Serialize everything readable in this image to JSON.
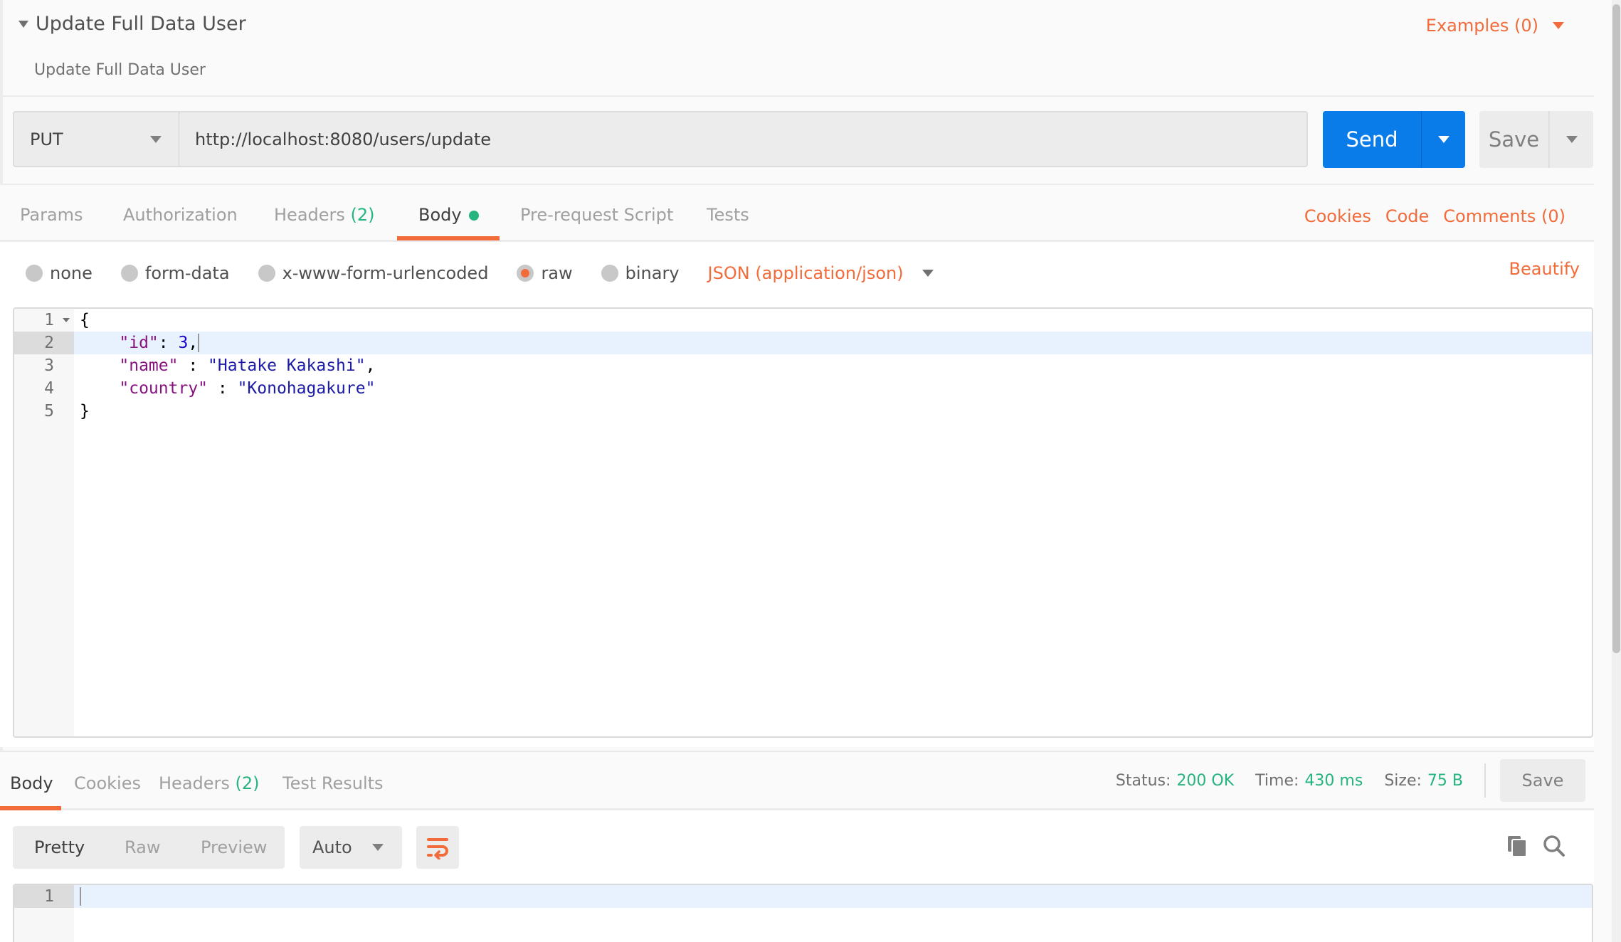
{
  "request": {
    "title": "Update Full Data User",
    "description": "Update Full Data User",
    "examples_label": "Examples (0)",
    "method": "PUT",
    "url": "http://localhost:8080/users/update",
    "send_label": "Send",
    "save_label": "Save"
  },
  "request_tabs": {
    "items": [
      {
        "label": "Params"
      },
      {
        "label": "Authorization"
      },
      {
        "label": "Headers",
        "count": "(2)"
      },
      {
        "label": "Body",
        "active": true,
        "indicator": "green-dot"
      },
      {
        "label": "Pre-request Script"
      },
      {
        "label": "Tests"
      }
    ],
    "right_links": [
      "Cookies",
      "Code",
      "Comments (0)"
    ]
  },
  "body_options": {
    "modes": [
      {
        "label": "none",
        "selected": false
      },
      {
        "label": "form-data",
        "selected": false
      },
      {
        "label": "x-www-form-urlencoded",
        "selected": false
      },
      {
        "label": "raw",
        "selected": true
      },
      {
        "label": "binary",
        "selected": false
      }
    ],
    "content_type": "JSON (application/json)",
    "beautify_label": "Beautify"
  },
  "editor": {
    "lines": [
      {
        "num": "1",
        "text": "{"
      },
      {
        "num": "2",
        "key": "\"id\"",
        "sep": ": ",
        "value": "3",
        "trail": ","
      },
      {
        "num": "3",
        "key": "\"name\"",
        "sep": " : ",
        "value": "\"Hatake Kakashi\"",
        "trail": ","
      },
      {
        "num": "4",
        "key": "\"country\"",
        "sep": " : ",
        "value": "\"Konohagakure\"",
        "trail": ""
      },
      {
        "num": "5",
        "text": "}"
      }
    ],
    "current_line": 2
  },
  "response": {
    "tabs": [
      {
        "label": "Body",
        "active": true
      },
      {
        "label": "Cookies"
      },
      {
        "label": "Headers",
        "count": "(2)"
      },
      {
        "label": "Test Results"
      }
    ],
    "status_label": "Status:",
    "status_value": "200 OK",
    "time_label": "Time:",
    "time_value": "430 ms",
    "size_label": "Size:",
    "size_value": "75 B",
    "save_label": "Save",
    "view_modes": [
      "Pretty",
      "Raw",
      "Preview"
    ],
    "active_view": "Pretty",
    "format": "Auto",
    "editor_line": "1"
  },
  "colors": {
    "accent": "#f26b3a",
    "send": "#0a7cea",
    "success": "#26b47f"
  }
}
